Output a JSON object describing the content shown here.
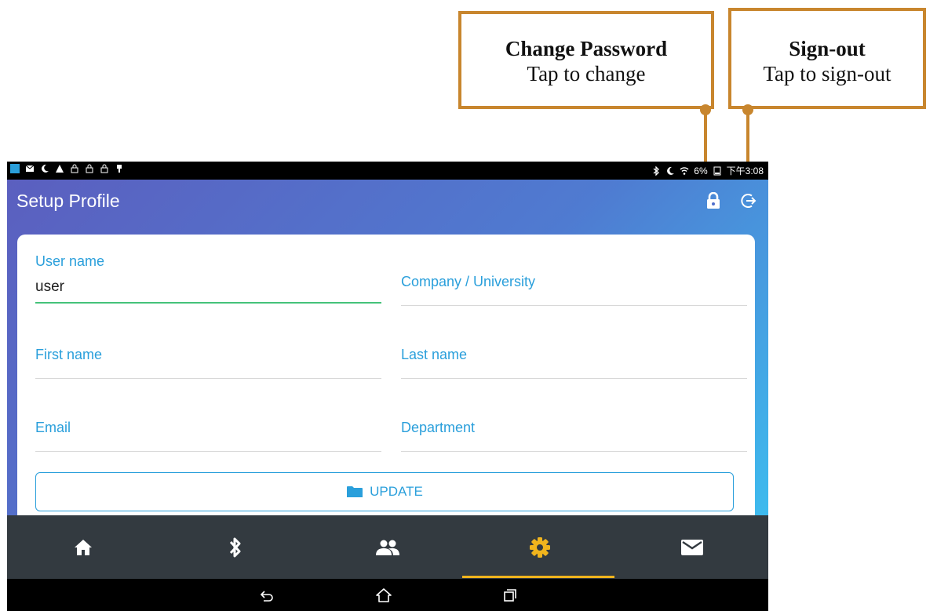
{
  "callouts": {
    "change_password": {
      "title": "Change Password",
      "subtitle": "Tap to change"
    },
    "sign_out": {
      "title": "Sign-out",
      "subtitle": "Tap to sign-out"
    }
  },
  "status_bar": {
    "battery": "6%",
    "time": "下午3:08",
    "left_icons": [
      "app-icon",
      "mail-icon",
      "moon-icon",
      "warning-icon",
      "lock-icon",
      "lock-icon",
      "lock-icon",
      "usb-icon"
    ],
    "right_icons": [
      "bluetooth-icon",
      "moon-icon",
      "wifi-icon",
      "battery-icon"
    ]
  },
  "header": {
    "title": "Setup Profile",
    "actions": [
      {
        "name": "change-password",
        "icon": "lock-icon"
      },
      {
        "name": "sign-out",
        "icon": "sign-out-icon"
      }
    ]
  },
  "form": {
    "user_name": {
      "label": "User name",
      "value": "user"
    },
    "company": {
      "label": "Company / University",
      "value": ""
    },
    "first_name": {
      "label": "First name",
      "value": ""
    },
    "last_name": {
      "label": "Last name",
      "value": ""
    },
    "email": {
      "label": "Email",
      "value": ""
    },
    "department": {
      "label": "Department",
      "value": ""
    },
    "update_button": {
      "label": "UPDATE",
      "icon": "folder-icon"
    }
  },
  "tabs": [
    {
      "name": "home",
      "icon": "home-icon",
      "active": false
    },
    {
      "name": "bluetooth",
      "icon": "bluetooth-icon",
      "active": false
    },
    {
      "name": "people",
      "icon": "people-icon",
      "active": false
    },
    {
      "name": "settings",
      "icon": "gear-icon",
      "active": true
    },
    {
      "name": "mail",
      "icon": "mail-icon",
      "active": false
    }
  ],
  "navbar": {
    "buttons": [
      "back-icon",
      "home-outline-icon",
      "recents-icon"
    ]
  },
  "colors": {
    "accent": "#2a9fdb",
    "active_tab": "#f0b41d",
    "focus_underline": "#44c27a",
    "callout_border": "#c8862e",
    "tabbar_bg": "#333a40"
  }
}
